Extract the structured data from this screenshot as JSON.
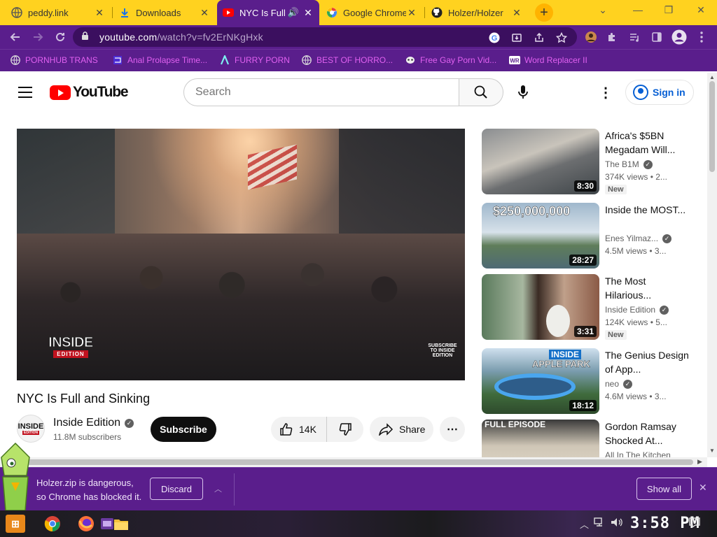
{
  "tabs": [
    {
      "title": "peddy.link",
      "favicon": "globe-icon",
      "active": false
    },
    {
      "title": "Downloads",
      "favicon": "download-icon",
      "active": false
    },
    {
      "title": "NYC Is Full",
      "favicon": "youtube-icon",
      "active": true,
      "audio": true
    },
    {
      "title": "Google Chrome",
      "favicon": "google-icon",
      "active": false
    },
    {
      "title": "Holzer/Holzer",
      "favicon": "github-icon",
      "active": false
    }
  ],
  "omnibox": {
    "host": "youtube.com",
    "path": "/watch?v=fv2ErNKgHxk"
  },
  "bookmarks": [
    {
      "label": "PORNHUB TRANS",
      "icon": "globe-icon"
    },
    {
      "label": "Anal Prolapse Time...",
      "icon": "bookmark-icon"
    },
    {
      "label": "FURRY PORN",
      "icon": "lambda-icon"
    },
    {
      "label": "BEST OF HORRO...",
      "icon": "globe-icon"
    },
    {
      "label": "Free Gay Porn Vid...",
      "icon": "mask-icon"
    },
    {
      "label": "Word Replacer II",
      "icon": "wr-icon"
    }
  ],
  "youtube": {
    "logo_text": "YouTube",
    "search_placeholder": "Search",
    "sign_in": "Sign in"
  },
  "player": {
    "watermark_top": "INSIDE",
    "watermark_bottom": "EDITION",
    "subscribe_cta": "SUBSCRIBE TO INSIDE EDITION"
  },
  "video": {
    "title": "NYC Is Full and Sinking",
    "channel": "Inside Edition",
    "subscribers": "11.8M subscribers",
    "subscribe_label": "Subscribe",
    "likes": "14K",
    "share_label": "Share",
    "channel_avatar_top": "INSIDE",
    "channel_avatar_bottom": "EDITION"
  },
  "related": [
    {
      "title": "Africa's $5BN Megadam Will...",
      "channel": "The B1M",
      "verified": true,
      "meta": "374K views • 2...",
      "duration": "8:30",
      "badge": "New"
    },
    {
      "title": "Inside the MOST...",
      "channel": "Enes Yilmaz...",
      "verified": true,
      "meta": "4.5M views • 3...",
      "duration": "28:27",
      "badge": "",
      "thumb_text": "$250,000,000"
    },
    {
      "title": "The Most Hilarious...",
      "channel": "Inside Edition",
      "verified": true,
      "meta": "124K views • 5...",
      "duration": "3:31",
      "badge": "New"
    },
    {
      "title": "The Genius Design of App...",
      "channel": "neo",
      "verified": true,
      "meta": "4.6M views • 3...",
      "duration": "18:12",
      "badge": "",
      "thumb_text_1": "INSIDE",
      "thumb_text_2": "APPLE PARK"
    },
    {
      "title": "Gordon Ramsay Shocked At...",
      "channel": "All In The Kitchen",
      "verified": false,
      "meta": "",
      "duration": "",
      "badge": "",
      "thumb_text": "FULL EPISODE"
    }
  ],
  "download_shelf": {
    "line1": "Holzer.zip is dangerous,",
    "line2": "so Chrome has blocked it.",
    "discard": "Discard",
    "show_all": "Show all"
  },
  "taskbar": {
    "clock": "3:58 PM"
  },
  "colors": {
    "tab_strip": "#ffd21f",
    "chrome_theme": "#5a1e8c",
    "yt_red": "#ff0000",
    "link_blue": "#065fd4"
  }
}
